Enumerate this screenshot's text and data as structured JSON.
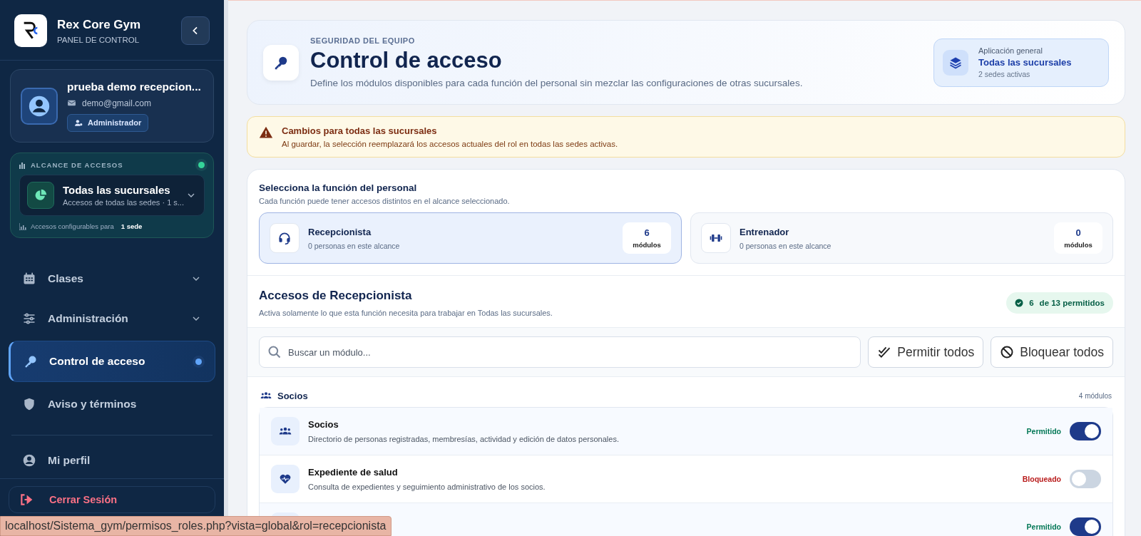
{
  "brand": {
    "title": "Rex Core Gym",
    "subtitle": "PANEL DE CONTROL"
  },
  "user": {
    "name": "prueba demo recepcion...",
    "email": "demo@gmail.com",
    "role": "Administrador"
  },
  "scope": {
    "label": "ALCANCE DE ACCESOS",
    "active": true,
    "title": "Todas las sucursales",
    "subtitle": "Accesos de todas las sedes · 1 s...",
    "footer_text": "Accesos configurables para",
    "footer_value": "1 sede"
  },
  "nav": [
    {
      "label": "Clases",
      "expandable": true,
      "selected": false
    },
    {
      "label": "Administración",
      "expandable": true,
      "selected": false
    },
    {
      "label": "Control de acceso",
      "expandable": false,
      "selected": true
    },
    {
      "label": "Aviso y términos",
      "expandable": false,
      "selected": false
    }
  ],
  "nav_bottom": [
    {
      "label": "Mi perfil",
      "expandable": false,
      "selected": false
    }
  ],
  "logout": "Cerrar Sesión",
  "status_url": "localhost/Sistema_gym/permisos_roles.php?vista=global&rol=recepcionista",
  "header": {
    "eyebrow": "SEGURIDAD DEL EQUIPO",
    "title": "Control de acceso",
    "description": "Define los módulos disponibles para cada función del personal sin mezclar las configuraciones de otras sucursales.",
    "scope_label": "Aplicación general",
    "scope_title": "Todas las sucursales",
    "scope_sub": "2 sedes activas"
  },
  "warning": {
    "title": "Cambios para todas las sucursales",
    "text": "Al guardar, la selección reemplazará los accesos actuales del rol en todas las sedes activas."
  },
  "roles_section": {
    "title": "Selecciona la función del personal",
    "subtitle": "Cada función puede tener accesos distintos en el alcance seleccionado."
  },
  "roles": [
    {
      "name": "Recepcionista",
      "people": "0 personas en este alcance",
      "count": "6",
      "unit": "módulos",
      "selected": true
    },
    {
      "name": "Entrenador",
      "people": "0 personas en este alcance",
      "count": "0",
      "unit": "módulos",
      "selected": false
    }
  ],
  "access": {
    "title": "Accesos de Recepcionista",
    "subtitle": "Activa solamente lo que esta función necesita para trabajar en Todas las sucursales.",
    "count": "6",
    "count_text": "de 13 permitidos"
  },
  "search": {
    "placeholder": "Buscar un módulo..."
  },
  "actions": [
    {
      "label": "Permitir todos"
    },
    {
      "label": "Bloquear todos"
    }
  ],
  "groups": [
    {
      "title": "Socios",
      "count": "4 módulos",
      "modules": [
        {
          "name": "Socios",
          "description": "Directorio de personas registradas, membresías, actividad y edición de datos personales.",
          "status": "Permitido",
          "on": true
        },
        {
          "name": "Expediente de salud",
          "description": "Consulta de expedientes y seguimiento administrativo de los socios.",
          "status": "Bloqueado",
          "on": false
        },
        {
          "status": "Permitido",
          "on": true
        }
      ]
    }
  ]
}
